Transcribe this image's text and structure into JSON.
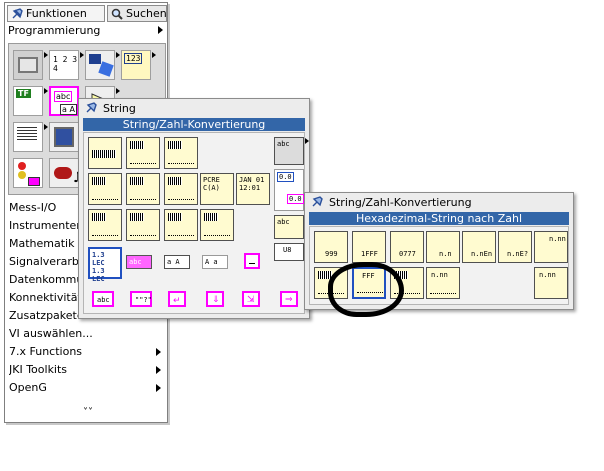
{
  "tabs": {
    "functions": "Funktionen",
    "search": "Suchen"
  },
  "main": {
    "title": "Programmierung",
    "categories": [
      "Mess-I/O",
      "Instrumenten-",
      "Mathematik",
      "Signalverarbeit",
      "Datenkommuni",
      "Konnektivität",
      "Zusatzpakete",
      "VI auswählen...",
      "7.x Functions",
      "JKI Toolkits",
      "OpenG"
    ]
  },
  "icons_main": {
    "tf": "TF",
    "array": "1 2 3 4",
    "num": "123",
    "str": "abc",
    "stra": "a A"
  },
  "string_palette": {
    "title": "String",
    "bar": "String/Zahl-Konvertierung",
    "labels": {
      "pcre": "PCRE C(A)",
      "jan": "JAN 01 12:01",
      "lec1": "1.3 LEC",
      "lec2": "1.3 LEC",
      "abc_pink": "abc",
      "aa1": "a A",
      "aa2": "A a",
      "abc2": "abc",
      "quote": "\"\"?\"",
      "abc_side": "abc",
      "num00": "0.0",
      "num00b": "0.0",
      "u8": "U8",
      "abc_bottom": "abc"
    }
  },
  "conv_palette": {
    "title": "String/Zahl-Konvertierung",
    "bar": "Hexadezimal-String nach Zahl",
    "labels": {
      "c1": "999",
      "c2": "1FFF",
      "c3": "0777",
      "c4": "n.n",
      "c5": "n.nEn",
      "c6": "n.nE?",
      "c7": "n.nn",
      "d2": "FFF",
      "d4": "n.nn",
      "d6": "n.nn"
    }
  },
  "colors": {
    "title_bar": "#3366a8",
    "magenta": "#ff00ff",
    "icon_fill": "#fffbd0"
  }
}
